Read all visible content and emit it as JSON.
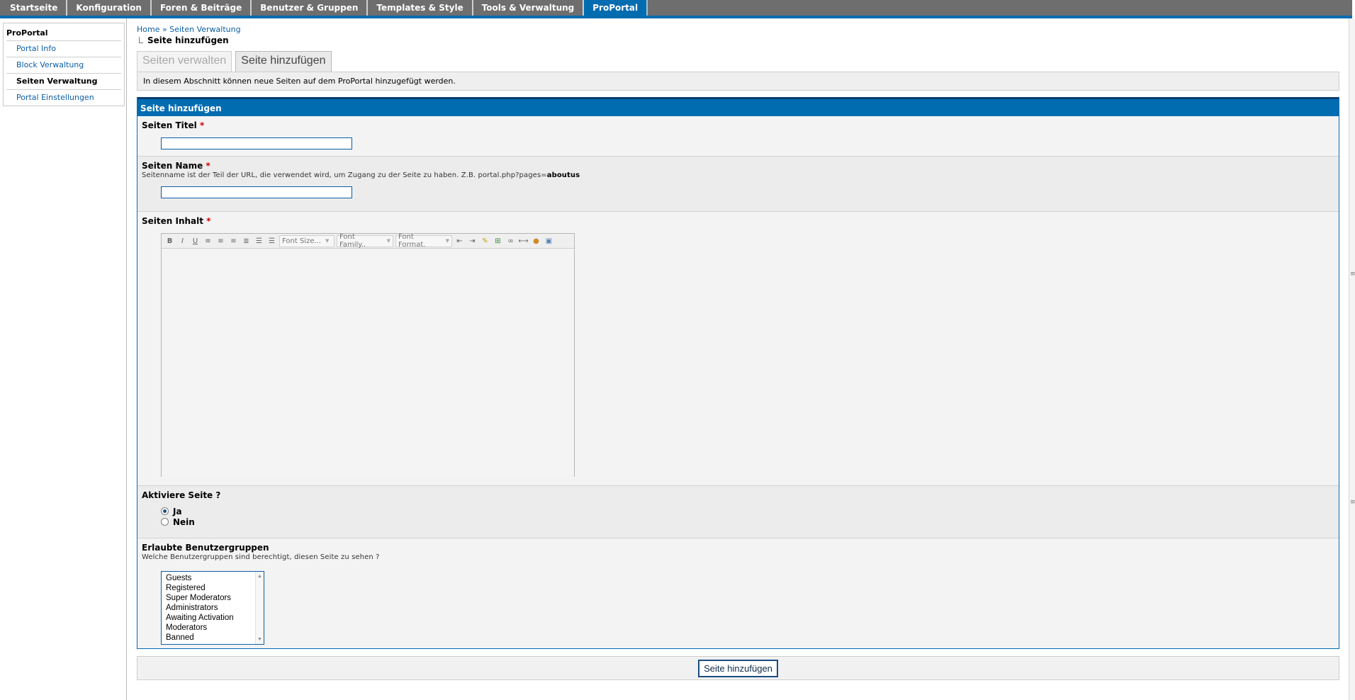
{
  "topmenu": {
    "tabs": [
      "Startseite",
      "Konfiguration",
      "Foren & Beiträge",
      "Benutzer & Gruppen",
      "Templates & Style",
      "Tools & Verwaltung",
      "ProPortal"
    ]
  },
  "sidebar": {
    "title": "ProPortal",
    "items": [
      "Portal Info",
      "Block Verwaltung",
      "Seiten Verwaltung",
      "Portal Einstellungen"
    ]
  },
  "breadcrumb": {
    "home": "Home",
    "separator": "»",
    "section": "Seiten Verwaltung",
    "current": "Seite hinzufügen"
  },
  "tabs": [
    "Seiten verwalten",
    "Seite hinzufügen"
  ],
  "intro_text": "In diesem Abschnitt können neue Seiten auf dem ProPortal hinzugefügt werden.",
  "form": {
    "header": "Seite hinzufügen",
    "required_mark": "*",
    "title_field": {
      "label": "Seiten Titel",
      "value": ""
    },
    "name_field": {
      "label": "Seiten Name",
      "description": "Seitenname ist der Teil der URL, die verwendet wird, um Zugang zu der Seite zu haben. Z.B. portal.php?pages=",
      "description_bold": "aboutus",
      "value": ""
    },
    "content_field": {
      "label": "Seiten Inhalt",
      "toolbar": {
        "bold": "B",
        "italic": "I",
        "underline": "U",
        "font_size": "Font Size...",
        "font_family": "Font Family..",
        "font_format": "Font Format."
      }
    },
    "activate": {
      "label": "Aktiviere Seite ?",
      "yes": "Ja",
      "no": "Nein",
      "selected": "Ja"
    },
    "groups": {
      "label": "Erlaubte Benutzergruppen",
      "description": "Welche Benutzergruppen sind berechtigt, diesen Seite zu sehen ?",
      "options": [
        "Guests",
        "Registered",
        "Super Moderators",
        "Administrators",
        "Awaiting Activation",
        "Moderators",
        "Banned"
      ]
    },
    "submit_label": "Seite hinzufügen"
  },
  "icons": {
    "align": "align-icon",
    "list": "list-icon",
    "indent": "indent-icon",
    "link": "link-icon",
    "image": "image-icon",
    "undo": "undo-icon"
  },
  "colors": {
    "accent": "#026cb1",
    "menu": "#6e6e6e",
    "link": "#0b5ea6",
    "required": "#cc0000"
  }
}
